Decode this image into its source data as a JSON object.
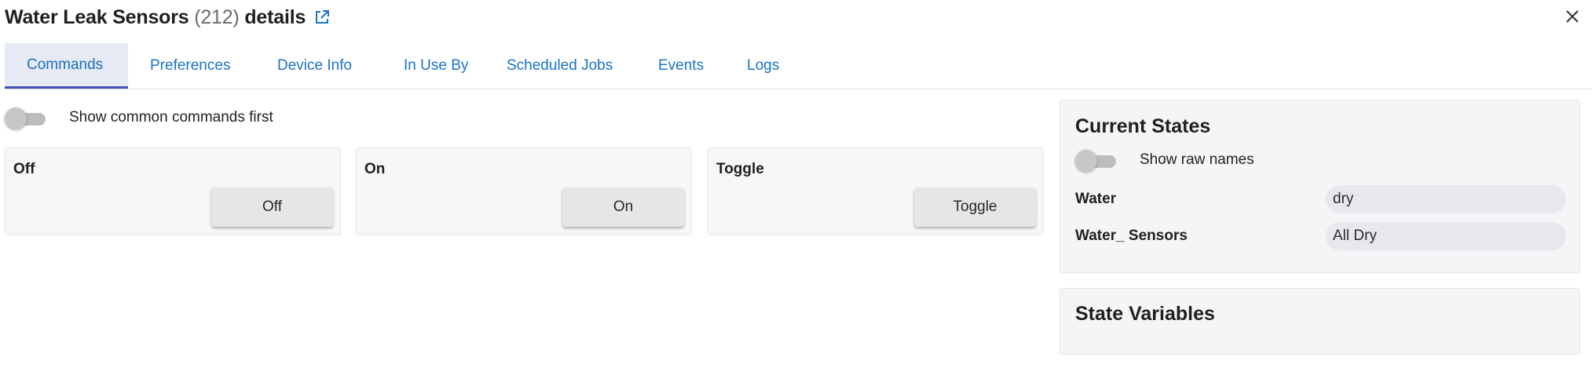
{
  "header": {
    "title_name": "Water Leak Sensors",
    "title_count": "(212)",
    "title_suffix": "details",
    "external_link_icon": "external-link-icon",
    "close_icon": "close-icon"
  },
  "tabs": [
    {
      "label": "Commands",
      "active": true
    },
    {
      "label": "Preferences",
      "active": false
    },
    {
      "label": "Device Info",
      "active": false
    },
    {
      "label": "In Use By",
      "active": false
    },
    {
      "label": "Scheduled Jobs",
      "active": false
    },
    {
      "label": "Events",
      "active": false
    },
    {
      "label": "Logs",
      "active": false
    }
  ],
  "commands": {
    "show_common_label": "Show common commands first",
    "show_common_enabled": false,
    "cards": [
      {
        "title": "Off",
        "button": "Off"
      },
      {
        "title": "On",
        "button": "On"
      },
      {
        "title": "Toggle",
        "button": "Toggle"
      }
    ]
  },
  "current_states": {
    "title": "Current States",
    "show_raw_label": "Show raw names",
    "show_raw_enabled": false,
    "rows": [
      {
        "name": "Water",
        "value": "dry"
      },
      {
        "name": "Water_ Sensors",
        "value": "All Dry"
      }
    ]
  },
  "state_variables": {
    "title": "State Variables"
  },
  "colors": {
    "link_blue": "#1a73c8",
    "active_tab_bg": "#e6eaf4",
    "active_tab_indicator": "#3f51b5",
    "panel_bg": "#f5f5f7"
  }
}
